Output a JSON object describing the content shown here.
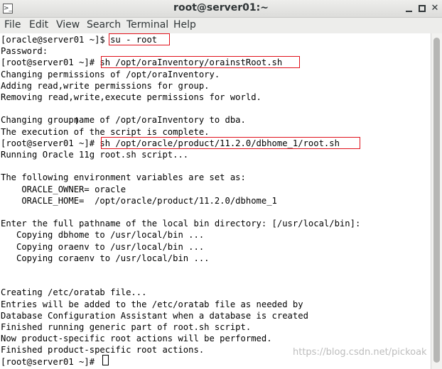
{
  "window": {
    "title": "root@server01:~",
    "app_icon": "terminal-icon",
    "controls": [
      "minimize-icon",
      "maximize-icon",
      "close-icon"
    ]
  },
  "menu": [
    "File",
    "Edit",
    "View",
    "Search",
    "Terminal",
    "Help"
  ],
  "terminal": {
    "lines": [
      "[oracle@server01 ~]$ su - root",
      "Password:",
      "[root@server01 ~]# sh /opt/oraInventory/orainstRoot.sh",
      "Changing permissions of /opt/oraInventory.",
      "Adding read,write permissions for group.",
      "Removing read,write,execute permissions for world.",
      "",
      "Changing groupname of /opt/oraInventory to dba.",
      "The execution of the script is complete.",
      "[root@server01 ~]# sh /opt/oracle/product/11.2.0/dbhome_1/root.sh",
      "Running Oracle 11g root.sh script...",
      "",
      "The following environment variables are set as:",
      "    ORACLE_OWNER= oracle",
      "    ORACLE_HOME=  /opt/oracle/product/11.2.0/dbhome_1",
      "",
      "Enter the full pathname of the local bin directory: [/usr/local/bin]:",
      "   Copying dbhome to /usr/local/bin ...",
      "   Copying oraenv to /usr/local/bin ...",
      "   Copying coraenv to /usr/local/bin ...",
      "",
      "",
      "Creating /etc/oratab file...",
      "Entries will be added to the /etc/oratab file as needed by",
      "Database Configuration Assistant when a database is created",
      "Finished running generic part of root.sh script.",
      "Now product-specific root actions will be performed.",
      "Finished product-specific root actions.",
      "[root@server01 ~]# "
    ],
    "highlight_color": "#e0101a"
  },
  "watermark": "https://blog.csdn.net/pickoak"
}
